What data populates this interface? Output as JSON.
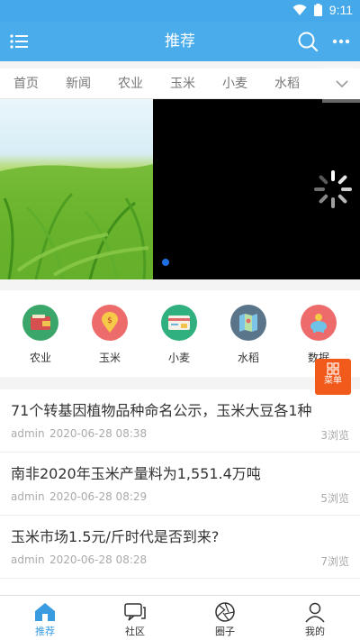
{
  "status_bar": {
    "time": "9:11"
  },
  "app_bar": {
    "title": "推荐"
  },
  "tabs": [
    "首页",
    "新闻",
    "农业",
    "玉米",
    "小麦",
    "水稻"
  ],
  "categories": [
    {
      "label": "农业",
      "color": "#3aa66a"
    },
    {
      "label": "玉米",
      "color": "#ee6b6b"
    },
    {
      "label": "小麦",
      "color": "#2fb07e"
    },
    {
      "label": "水稻",
      "color": "#5a7589"
    },
    {
      "label": "数据",
      "color": "#ee6b6b"
    }
  ],
  "news": [
    {
      "title": "71个转基因植物品种命名公示，玉米大豆各1种",
      "author": "admin",
      "time": "2020-06-28 08:38",
      "views": "3浏览"
    },
    {
      "title": "南非2020年玉米产量料为1,551.4万吨",
      "author": "admin",
      "time": "2020-06-28 08:29",
      "views": "5浏览"
    },
    {
      "title": "玉米市场1.5元/斤时代是否到来?",
      "author": "admin",
      "time": "2020-06-28 08:28",
      "views": "7浏览"
    }
  ],
  "float_menu": {
    "label": "菜单",
    "color": "#f25a1c"
  },
  "bottom_nav": [
    {
      "label": "推荐",
      "icon": "home-icon",
      "active": true
    },
    {
      "label": "社区",
      "icon": "community-icon",
      "active": false
    },
    {
      "label": "圈子",
      "icon": "circle-icon",
      "active": false
    },
    {
      "label": "我的",
      "icon": "user-icon",
      "active": false
    }
  ],
  "colors": {
    "primary": "#4aacea",
    "accent": "#f25a1c"
  }
}
